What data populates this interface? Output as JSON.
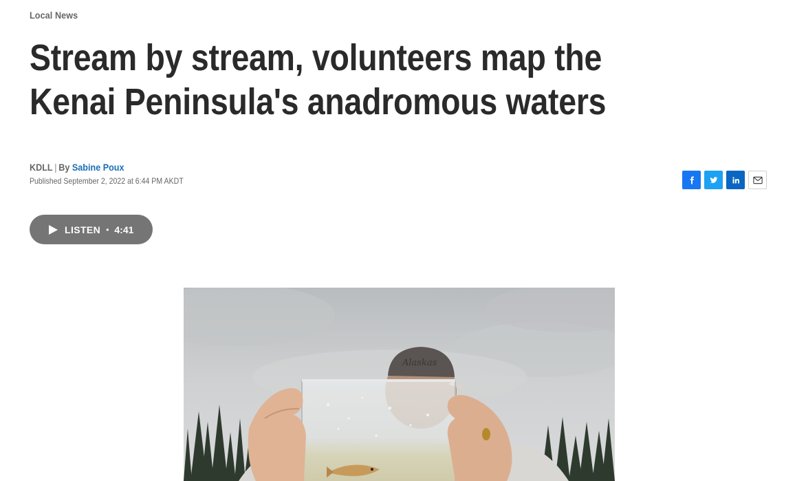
{
  "article": {
    "section": "Local News",
    "headline": "Stream by stream, volunteers map the Kenai Peninsula's anadromous waters",
    "source": "KDLL",
    "by_label": "By",
    "author": "Sabine Poux",
    "published": "Published September 2, 2022 at 6:44 PM AKDT"
  },
  "share": {
    "icons": [
      "facebook-icon",
      "twitter-icon",
      "linkedin-icon",
      "email-icon"
    ]
  },
  "audio": {
    "listen_label": "LISTEN",
    "separator": "•",
    "duration": "4:41"
  },
  "photo": {
    "hat_text": "Alaskas"
  },
  "colors": {
    "facebook": "#1877f2",
    "twitter": "#1da1f2",
    "linkedin": "#0a66c2",
    "author_link": "#1a6fb8",
    "listen_button": "#757575"
  }
}
